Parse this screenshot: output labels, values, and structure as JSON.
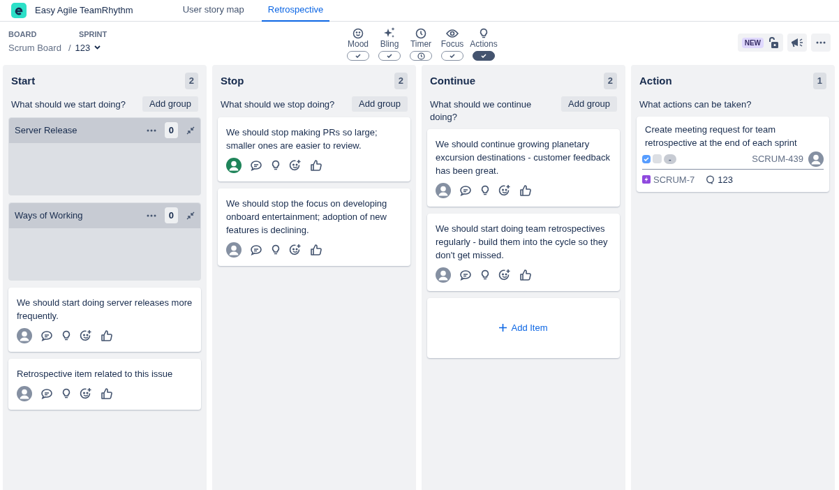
{
  "app": {
    "name": "Easy Agile TeamRhythm"
  },
  "tabs": [
    {
      "label": "User story map",
      "selected": false
    },
    {
      "label": "Retrospective",
      "selected": true
    }
  ],
  "board": {
    "board_label": "BOARD",
    "board_value": "Scrum Board",
    "separator": "/",
    "sprint_label": "SPRINT",
    "sprint_value": "123"
  },
  "toggles": [
    {
      "label": "Mood",
      "kind": "check",
      "on": false
    },
    {
      "label": "Bling",
      "kind": "check",
      "on": false
    },
    {
      "label": "Timer",
      "kind": "clock",
      "on": false
    },
    {
      "label": "Focus",
      "kind": "check",
      "on": false
    },
    {
      "label": "Actions",
      "kind": "check",
      "on": true
    }
  ],
  "toolbar": {
    "badge": "NEW"
  },
  "columns": [
    {
      "title": "Start",
      "count": "2",
      "prompt": "What should we start doing?",
      "add_group": "Add group",
      "groups": [
        {
          "title": "Server Release",
          "count": "0"
        },
        {
          "title": "Ways of Working",
          "count": "0"
        }
      ],
      "items": [
        {
          "text": "We should start doing server releases more frequently.",
          "color": "#8590a2"
        },
        {
          "text": "Retrospective item related to this issue",
          "color": "#8590a2"
        }
      ]
    },
    {
      "title": "Stop",
      "count": "2",
      "prompt": "What should we stop doing?",
      "add_group": "Add group",
      "items": [
        {
          "text": "We should stop making PRs so large; smaller ones are easier to review.",
          "color": "#1f845a"
        },
        {
          "text": "We should stop the focus on developing onboard entertainment; adoption of new features is declining.",
          "color": "#8590a2"
        }
      ]
    },
    {
      "title": "Continue",
      "count": "2",
      "prompt": "What should we continue doing?",
      "add_group": "Add group",
      "items": [
        {
          "text": "We should continue growing planetary excursion destinations - customer feedback has been great.",
          "color": "#8590a2"
        },
        {
          "text": "We should start doing team retrospectives regularly - build them into the cycle so they don't get missed.",
          "color": "#8590a2"
        }
      ],
      "add_item": "Add Item"
    },
    {
      "title": "Action",
      "count": "1",
      "prompt": "What actions can be taken?",
      "actions": [
        {
          "text": "Create meeting request for team retrospective at the end of each sprint",
          "checked": true,
          "status": "-",
          "key": "SCRUM-439",
          "parent": "SCRUM-7",
          "comments": "123"
        }
      ]
    }
  ]
}
